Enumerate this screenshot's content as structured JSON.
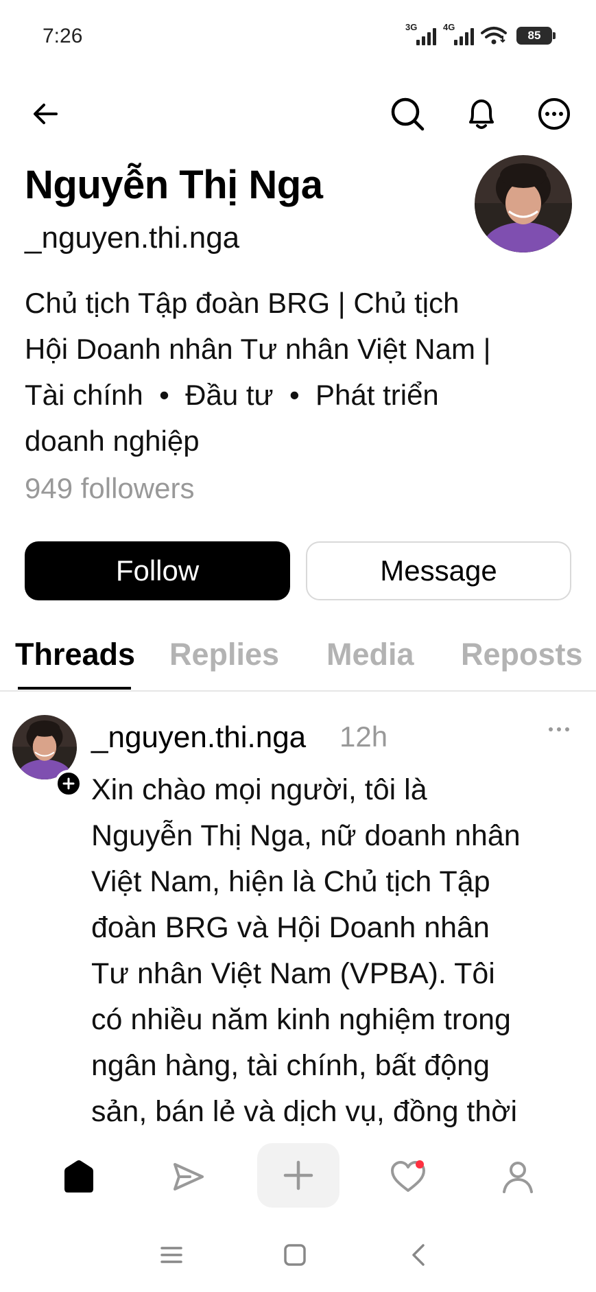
{
  "status_bar": {
    "time": "7:26",
    "network_1": "3G",
    "network_2": "4G",
    "battery": "85"
  },
  "top_nav": {
    "icons": [
      "arrow-left-icon",
      "search-icon",
      "bell-icon",
      "more-horizontal-icon"
    ]
  },
  "profile": {
    "name": "Nguyễn Thị Nga",
    "handle": "_nguyen.thi.nga",
    "bio_lines": [
      "Chủ tịch Tập đoàn BRG | Chủ tịch",
      "Hội Doanh nhân Tư nhân Việt Nam |",
      "Tài chính  •  Đầu tư  •  Phát triển",
      "doanh nghiệp"
    ],
    "followers": "949 followers"
  },
  "actions": {
    "follow_label": "Follow",
    "message_label": "Message"
  },
  "tabs": [
    {
      "label": "Threads",
      "active": true
    },
    {
      "label": "Replies",
      "active": false
    },
    {
      "label": "Media",
      "active": false
    },
    {
      "label": "Reposts",
      "active": false
    }
  ],
  "post": {
    "author": "_nguyen.thi.nga",
    "time": "12h",
    "text_lines": [
      "Xin chào mọi người, tôi là",
      "Nguyễn Thị Nga, nữ doanh nhân",
      "Việt Nam, hiện là Chủ tịch Tập",
      "đoàn BRG và Hội Doanh nhân",
      "Tư nhân Việt Nam (VPBA). Tôi",
      "có nhiều năm kinh nghiệm trong",
      "ngân hàng, tài chính, bất động",
      "sản, bán lẻ và dịch vụ, đồng thời"
    ]
  },
  "bottom_nav": {
    "icons": [
      "home-icon",
      "send-icon",
      "plus-icon",
      "heart-icon",
      "person-icon"
    ],
    "notification_color": "#ff3040"
  },
  "colors": {
    "accent": "#000000",
    "muted_text": "#999999",
    "inactive_tab": "#b3b3b3"
  }
}
